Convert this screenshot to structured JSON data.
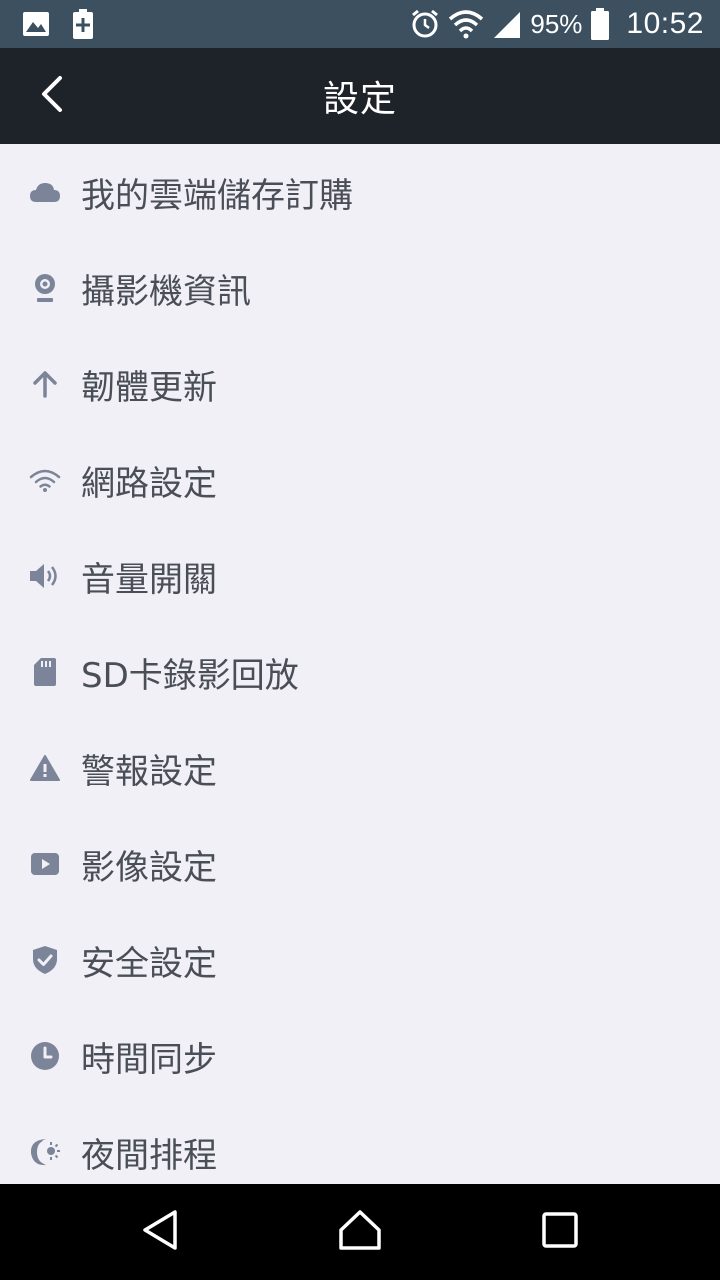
{
  "status_bar": {
    "battery": "95%",
    "clock": "10:52",
    "icons": [
      "image-icon",
      "battery-saver-icon",
      "alarm-icon",
      "wifi-icon",
      "signal-icon",
      "battery-icon"
    ]
  },
  "header": {
    "title": "設定",
    "back_icon": "chevron-left-icon"
  },
  "settings": [
    {
      "icon": "cloud-icon",
      "label": "我的雲端儲存訂購"
    },
    {
      "icon": "camera-icon",
      "label": "攝影機資訊"
    },
    {
      "icon": "arrow-up-icon",
      "label": "韌體更新"
    },
    {
      "icon": "wifi-icon",
      "label": "網路設定"
    },
    {
      "icon": "speaker-icon",
      "label": "音量開關"
    },
    {
      "icon": "sd-card-icon",
      "label": "SD卡錄影回放"
    },
    {
      "icon": "warning-icon",
      "label": "警報設定"
    },
    {
      "icon": "video-icon",
      "label": "影像設定"
    },
    {
      "icon": "shield-icon",
      "label": "安全設定"
    },
    {
      "icon": "clock-icon",
      "label": "時間同步"
    },
    {
      "icon": "night-icon",
      "label": "夜間排程"
    }
  ],
  "nav_bar": {
    "icons": [
      "back-triangle-icon",
      "home-icon",
      "recents-square-icon"
    ]
  },
  "colors": {
    "status_bar_bg": "#3c5060",
    "app_bar_bg": "#1e2229",
    "list_bg": "#f0f0f6",
    "icon_color": "#7c8499",
    "label_color": "#4a4e56"
  }
}
